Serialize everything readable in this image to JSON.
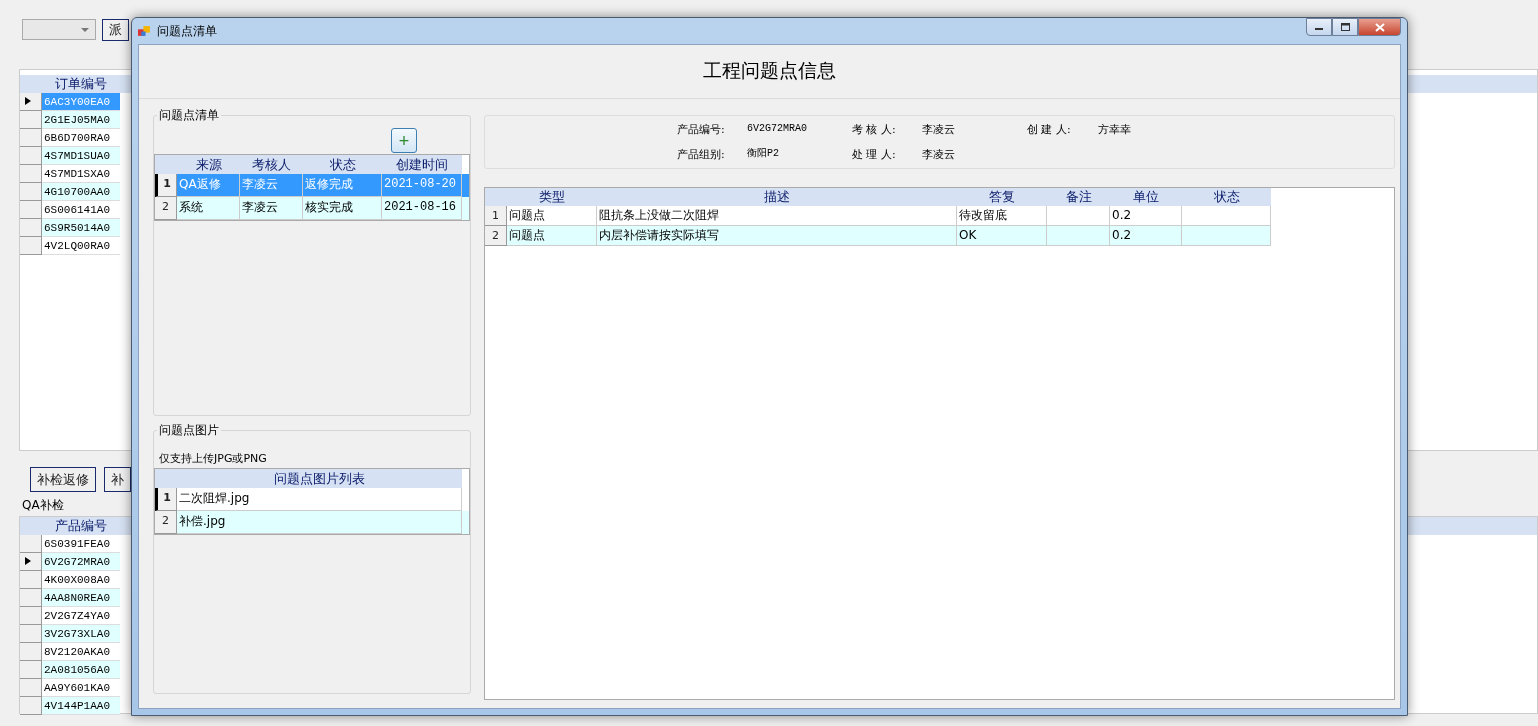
{
  "background_app": {
    "dispatch_button": "派",
    "order_grid": {
      "columns": [
        "订单编号"
      ],
      "rows": [
        {
          "order_no": "6AC3Y00EA0",
          "selected": true,
          "current": true
        },
        {
          "order_no": "2G1EJ05MA0",
          "selected": false,
          "current": false
        },
        {
          "order_no": "6B6D700RA0",
          "selected": false,
          "current": false
        },
        {
          "order_no": "4S7MD1SUA0",
          "selected": false,
          "current": false
        },
        {
          "order_no": "4S7MD1SXA0",
          "selected": false,
          "current": false
        },
        {
          "order_no": "4G10700AA0",
          "selected": false,
          "current": false
        },
        {
          "order_no": "6S006141A0",
          "selected": false,
          "current": false
        },
        {
          "order_no": "6S9R5014A0",
          "selected": false,
          "current": false
        },
        {
          "order_no": "4V2LQ00RA0",
          "selected": false,
          "current": false
        }
      ]
    },
    "buttons": [
      "补检返修",
      "补"
    ],
    "section_label": "QA补检",
    "product_grid": {
      "columns": [
        "产品编号"
      ],
      "rows": [
        {
          "product_no": "6S0391FEA0",
          "current": false
        },
        {
          "product_no": "6V2G72MRA0",
          "current": true
        },
        {
          "product_no": "4K00X008A0",
          "current": false
        },
        {
          "product_no": "4AA8N0REA0",
          "current": false
        },
        {
          "product_no": "2V2G7Z4YA0",
          "current": false
        },
        {
          "product_no": "3V2G73XLA0",
          "current": false
        },
        {
          "product_no": "8V2120AKA0",
          "current": false
        },
        {
          "product_no": "2A081056A0",
          "current": false
        },
        {
          "product_no": "AA9Y601KA0",
          "current": false
        },
        {
          "product_no": "4V144P1AA0",
          "current": false
        }
      ]
    }
  },
  "dialog": {
    "title": "问题点清单",
    "heading": "工程问题点信息",
    "issue_group": {
      "title": "问题点清单",
      "add_button": "+",
      "columns": [
        "来源",
        "考核人",
        "状态",
        "创建时间"
      ],
      "rows": [
        {
          "row_no": "1",
          "source": "QA返修",
          "reviewer": "李凌云",
          "status": "返修完成",
          "created": "2021-08-20",
          "selected": true,
          "current": true
        },
        {
          "row_no": "2",
          "source": "系统",
          "reviewer": "李凌云",
          "status": "核实完成",
          "created": "2021-08-16",
          "selected": false,
          "current": false
        }
      ]
    },
    "picture_group": {
      "title": "问题点图片",
      "hint": "仅支持上传JPG或PNG",
      "column": "问题点图片列表",
      "rows": [
        {
          "row_no": "1",
          "file": "二次阻焊.jpg",
          "current": true
        },
        {
          "row_no": "2",
          "file": "补偿.jpg",
          "current": false
        }
      ]
    },
    "info": [
      [
        {
          "label": "产品编号:",
          "value": "6V2G72MRA0"
        },
        {
          "label": "考 核 人:",
          "value": "李凌云"
        },
        {
          "label": "创 建 人:",
          "value": "方幸幸"
        }
      ],
      [
        {
          "label": "产品组别:",
          "value": "衡阳P2"
        },
        {
          "label": "处 理 人:",
          "value": "李凌云"
        }
      ]
    ],
    "detail_grid": {
      "columns": [
        "类型",
        "描述",
        "答复",
        "备注",
        "单位",
        "状态"
      ],
      "rows": [
        {
          "row_no": "1",
          "cells": [
            "问题点",
            "阻抗条上没做二次阻焊",
            "待改留底",
            "",
            "0.2",
            ""
          ]
        },
        {
          "row_no": "2",
          "cells": [
            "问题点",
            "内层补偿请按实际填写",
            "OK",
            "",
            "0.2",
            ""
          ]
        }
      ]
    }
  }
}
